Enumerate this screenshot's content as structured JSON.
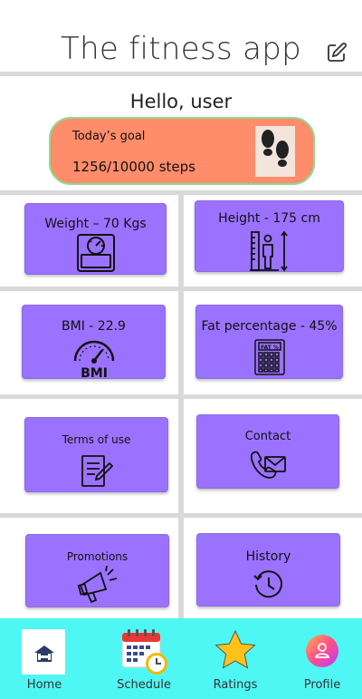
{
  "app": {
    "title": "The fitness app"
  },
  "greeting": "Hello, user",
  "goal": {
    "label": "Today’s goal",
    "value": "1256/10000 steps",
    "icon": "footprints-icon"
  },
  "cards": {
    "weight": {
      "label": "Weight  – 70 Kgs",
      "icon": "scale-icon"
    },
    "height": {
      "label": "Height - 175 cm",
      "icon": "height-measure-icon"
    },
    "bmi": {
      "label": "BMI - 22.9",
      "icon": "bmi-gauge-icon",
      "icon_text": "BMI"
    },
    "fat": {
      "label": "Fat percentage - 45%",
      "icon": "fat-calculator-icon",
      "icon_text": "FAT %"
    },
    "terms": {
      "label": "Terms of use",
      "icon": "document-icon"
    },
    "contact": {
      "label": "Contact",
      "icon": "phone-mail-icon"
    },
    "promotions": {
      "label": "Promotions",
      "icon": "megaphone-icon"
    },
    "history": {
      "label": "History",
      "icon": "history-icon"
    }
  },
  "nav": {
    "home": "Home",
    "schedule": "Schedule",
    "ratings": "Ratings",
    "profile": "Profile"
  },
  "colors": {
    "card": "#9b72ff",
    "goal": "#ff8c6b",
    "nav": "#4ff7f4",
    "star": "#ffc21a"
  }
}
